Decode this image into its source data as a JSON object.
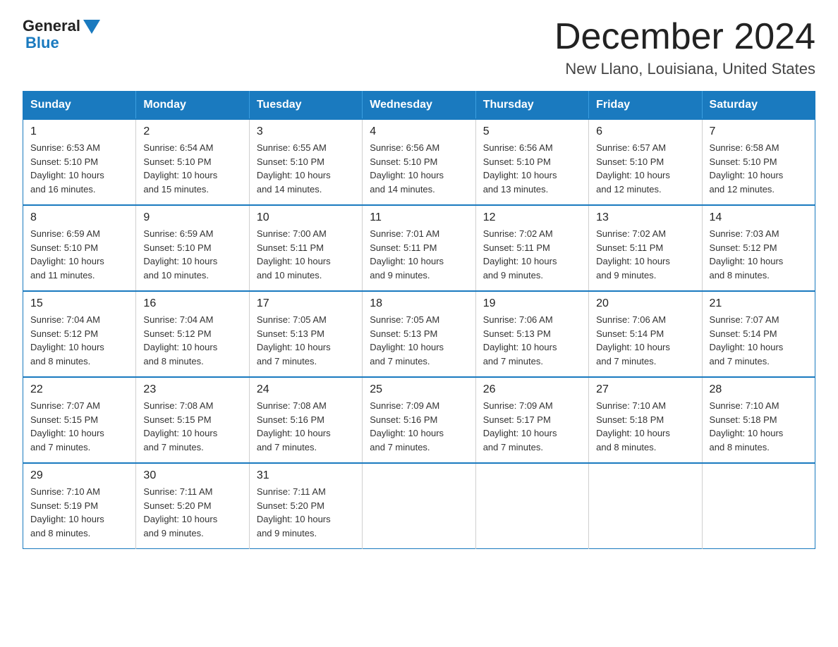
{
  "logo": {
    "general": "General",
    "blue": "Blue"
  },
  "title": "December 2024",
  "subtitle": "New Llano, Louisiana, United States",
  "weekdays": [
    "Sunday",
    "Monday",
    "Tuesday",
    "Wednesday",
    "Thursday",
    "Friday",
    "Saturday"
  ],
  "weeks": [
    [
      {
        "day": "1",
        "sunrise": "6:53 AM",
        "sunset": "5:10 PM",
        "daylight": "10 hours and 16 minutes."
      },
      {
        "day": "2",
        "sunrise": "6:54 AM",
        "sunset": "5:10 PM",
        "daylight": "10 hours and 15 minutes."
      },
      {
        "day": "3",
        "sunrise": "6:55 AM",
        "sunset": "5:10 PM",
        "daylight": "10 hours and 14 minutes."
      },
      {
        "day": "4",
        "sunrise": "6:56 AM",
        "sunset": "5:10 PM",
        "daylight": "10 hours and 14 minutes."
      },
      {
        "day": "5",
        "sunrise": "6:56 AM",
        "sunset": "5:10 PM",
        "daylight": "10 hours and 13 minutes."
      },
      {
        "day": "6",
        "sunrise": "6:57 AM",
        "sunset": "5:10 PM",
        "daylight": "10 hours and 12 minutes."
      },
      {
        "day": "7",
        "sunrise": "6:58 AM",
        "sunset": "5:10 PM",
        "daylight": "10 hours and 12 minutes."
      }
    ],
    [
      {
        "day": "8",
        "sunrise": "6:59 AM",
        "sunset": "5:10 PM",
        "daylight": "10 hours and 11 minutes."
      },
      {
        "day": "9",
        "sunrise": "6:59 AM",
        "sunset": "5:10 PM",
        "daylight": "10 hours and 10 minutes."
      },
      {
        "day": "10",
        "sunrise": "7:00 AM",
        "sunset": "5:11 PM",
        "daylight": "10 hours and 10 minutes."
      },
      {
        "day": "11",
        "sunrise": "7:01 AM",
        "sunset": "5:11 PM",
        "daylight": "10 hours and 9 minutes."
      },
      {
        "day": "12",
        "sunrise": "7:02 AM",
        "sunset": "5:11 PM",
        "daylight": "10 hours and 9 minutes."
      },
      {
        "day": "13",
        "sunrise": "7:02 AM",
        "sunset": "5:11 PM",
        "daylight": "10 hours and 9 minutes."
      },
      {
        "day": "14",
        "sunrise": "7:03 AM",
        "sunset": "5:12 PM",
        "daylight": "10 hours and 8 minutes."
      }
    ],
    [
      {
        "day": "15",
        "sunrise": "7:04 AM",
        "sunset": "5:12 PM",
        "daylight": "10 hours and 8 minutes."
      },
      {
        "day": "16",
        "sunrise": "7:04 AM",
        "sunset": "5:12 PM",
        "daylight": "10 hours and 8 minutes."
      },
      {
        "day": "17",
        "sunrise": "7:05 AM",
        "sunset": "5:13 PM",
        "daylight": "10 hours and 7 minutes."
      },
      {
        "day": "18",
        "sunrise": "7:05 AM",
        "sunset": "5:13 PM",
        "daylight": "10 hours and 7 minutes."
      },
      {
        "day": "19",
        "sunrise": "7:06 AM",
        "sunset": "5:13 PM",
        "daylight": "10 hours and 7 minutes."
      },
      {
        "day": "20",
        "sunrise": "7:06 AM",
        "sunset": "5:14 PM",
        "daylight": "10 hours and 7 minutes."
      },
      {
        "day": "21",
        "sunrise": "7:07 AM",
        "sunset": "5:14 PM",
        "daylight": "10 hours and 7 minutes."
      }
    ],
    [
      {
        "day": "22",
        "sunrise": "7:07 AM",
        "sunset": "5:15 PM",
        "daylight": "10 hours and 7 minutes."
      },
      {
        "day": "23",
        "sunrise": "7:08 AM",
        "sunset": "5:15 PM",
        "daylight": "10 hours and 7 minutes."
      },
      {
        "day": "24",
        "sunrise": "7:08 AM",
        "sunset": "5:16 PM",
        "daylight": "10 hours and 7 minutes."
      },
      {
        "day": "25",
        "sunrise": "7:09 AM",
        "sunset": "5:16 PM",
        "daylight": "10 hours and 7 minutes."
      },
      {
        "day": "26",
        "sunrise": "7:09 AM",
        "sunset": "5:17 PM",
        "daylight": "10 hours and 7 minutes."
      },
      {
        "day": "27",
        "sunrise": "7:10 AM",
        "sunset": "5:18 PM",
        "daylight": "10 hours and 8 minutes."
      },
      {
        "day": "28",
        "sunrise": "7:10 AM",
        "sunset": "5:18 PM",
        "daylight": "10 hours and 8 minutes."
      }
    ],
    [
      {
        "day": "29",
        "sunrise": "7:10 AM",
        "sunset": "5:19 PM",
        "daylight": "10 hours and 8 minutes."
      },
      {
        "day": "30",
        "sunrise": "7:11 AM",
        "sunset": "5:20 PM",
        "daylight": "10 hours and 9 minutes."
      },
      {
        "day": "31",
        "sunrise": "7:11 AM",
        "sunset": "5:20 PM",
        "daylight": "10 hours and 9 minutes."
      },
      null,
      null,
      null,
      null
    ]
  ],
  "labels": {
    "sunrise": "Sunrise:",
    "sunset": "Sunset:",
    "daylight": "Daylight:"
  },
  "colors": {
    "header_bg": "#1a7abf",
    "border": "#1a7abf"
  }
}
